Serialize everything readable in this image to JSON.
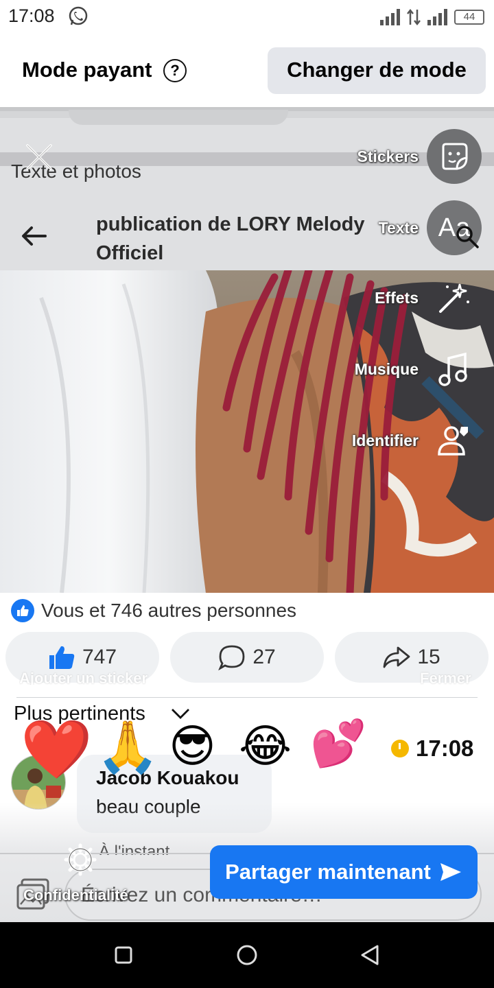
{
  "status_bar": {
    "time": "17:08",
    "battery": "44"
  },
  "mode_header": {
    "title": "Mode payant",
    "help_icon": "?",
    "change_mode": "Changer de mode"
  },
  "background_page": {
    "texte_photos": "Texte et photos",
    "post_title": "publication de LORY Melody Officiel"
  },
  "tools": [
    {
      "label": "Stickers",
      "icon": "sticker-icon"
    },
    {
      "label": "Texte",
      "icon": "text-aa-icon"
    },
    {
      "label": "Effets",
      "icon": "magic-wand-icon"
    },
    {
      "label": "Musique",
      "icon": "music-note-icon"
    },
    {
      "label": "Identifier",
      "icon": "tag-person-icon"
    }
  ],
  "reactions": {
    "summary": "Vous et 746 autres personnes"
  },
  "actions": {
    "likes": "747",
    "comments": "27",
    "shares": "15"
  },
  "faded_labels": {
    "add_sticker": "Ajouter un sticker",
    "close": "Fermer"
  },
  "sort": {
    "label": "Plus pertinents"
  },
  "stickers_row": [
    "❤️",
    "🙏",
    "😎",
    "😂",
    "💕"
  ],
  "timer": {
    "time": "17:08"
  },
  "comment": {
    "author": "Jacob Kouakou",
    "text": "beau couple",
    "ago": "À l'instant"
  },
  "composer": {
    "placeholder": "Écrivez un commentaire…"
  },
  "privacy": {
    "label": "Confidentialité"
  },
  "share_now": {
    "label": "Partager maintenant"
  },
  "colors": {
    "facebook_blue": "#1877f2",
    "pill_bg": "#eff1f3",
    "timer_yellow": "#f5b800"
  }
}
